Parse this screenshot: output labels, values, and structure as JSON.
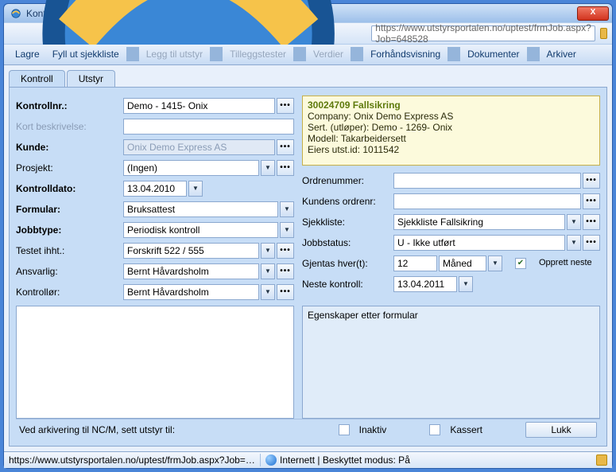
{
  "window": {
    "title": "Kontroll -- Dialogboks for webside"
  },
  "address": {
    "url": "https://www.utstyrsportalen.no/uptest/frmJob.aspx?Job=648528"
  },
  "menu": {
    "lagre": "Lagre",
    "fyllut": "Fyll ut sjekkliste",
    "leggtil": "Legg til utstyr",
    "tillegg": "Tilleggstester",
    "verdier": "Verdier",
    "forhand": "Forhåndsvisning",
    "dokumenter": "Dokumenter",
    "arkiver": "Arkiver"
  },
  "tabs": {
    "kontroll": "Kontroll",
    "utstyr": "Utstyr"
  },
  "labels": {
    "kontrollnr": "Kontrollnr.:",
    "kort": "Kort beskrivelse:",
    "kunde": "Kunde:",
    "prosjekt": "Prosjekt:",
    "kontrolldato": "Kontrolldato:",
    "formular": "Formular:",
    "jobbtype": "Jobbtype:",
    "testet": "Testet ihht.:",
    "ansvarlig": "Ansvarlig:",
    "kontrollor": "Kontrollør:",
    "ordrenummer": "Ordrenummer:",
    "kundensordre": "Kundens ordrenr:",
    "sjekkliste": "Sjekkliste:",
    "jobbstatus": "Jobbstatus:",
    "gjentas": "Gjentas hver(t):",
    "opprettneste": "Opprett neste",
    "nestekontroll": "Neste kontroll:",
    "egenskaper": "Egenskaper etter formular"
  },
  "values": {
    "kontrollnr": "Demo - 1415- Onix",
    "kort": "",
    "kunde": "Onix Demo Express AS",
    "prosjekt": "(Ingen)",
    "kontrolldato": "13.04.2010",
    "formular": "Bruksattest",
    "jobbtype": "Periodisk kontroll",
    "testet": "Forskrift 522 / 555",
    "ansvarlig": "Bernt Håvardsholm",
    "kontrollor": "Bernt Håvardsholm",
    "ordrenummer": "",
    "kundensordre": "",
    "sjekkliste": "Sjekkliste Fallsikring",
    "jobbstatus": "U - Ikke utført",
    "gjentas_num": "12",
    "gjentas_unit": "Måned",
    "nestekontroll": "13.04.2011"
  },
  "info": {
    "title": "30024709 Fallsikring",
    "l1": "Company: Onix Demo Express AS",
    "l2": "Sert. (utløper): Demo - 1269- Onix",
    "l3": "Modell: Takarbeidersett",
    "l4": "Eiers utst.id: 1011542"
  },
  "footer": {
    "arch_label": "Ved arkivering til NC/M, sett utstyr til:",
    "inaktiv": "Inaktiv",
    "kassert": "Kassert",
    "lukk": "Lukk"
  },
  "status": {
    "path": "https://www.utstyrsportalen.no/uptest/frmJob.aspx?Job=64",
    "mode": "Internett | Beskyttet modus: På"
  }
}
